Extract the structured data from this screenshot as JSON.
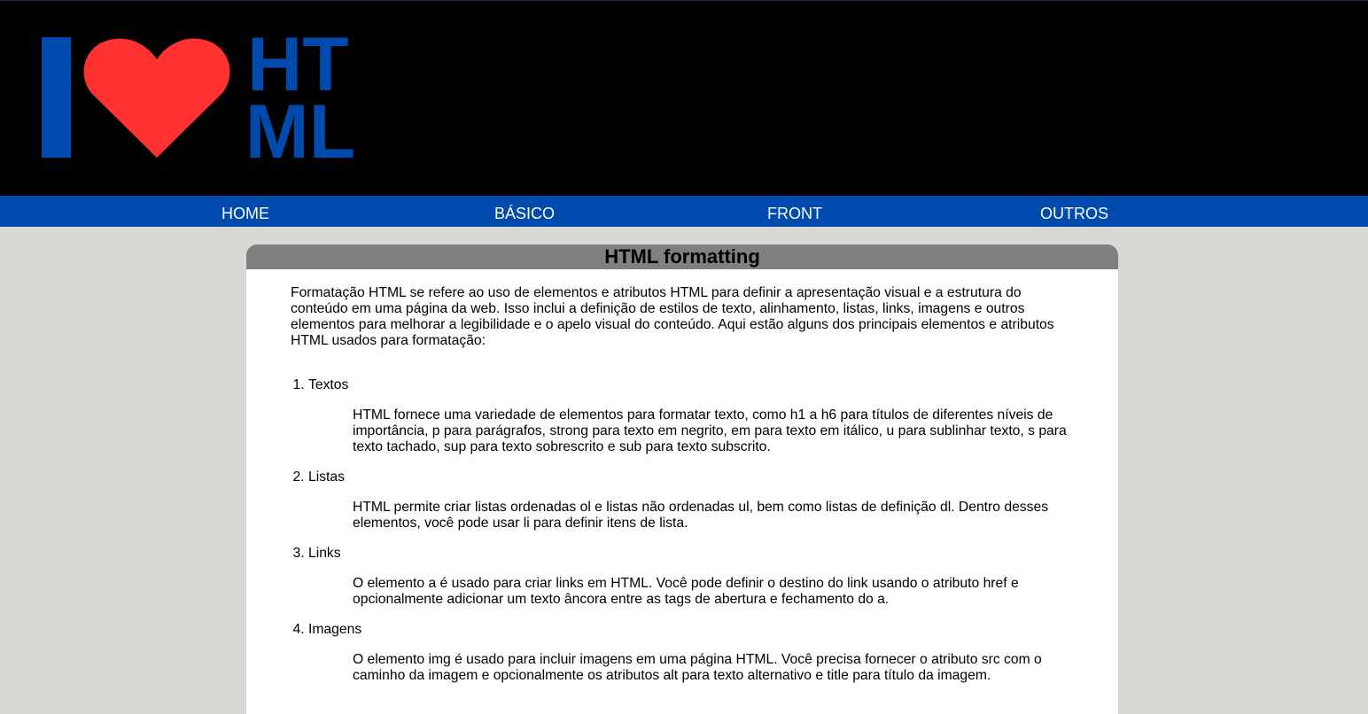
{
  "logo": {
    "icon": "heart-icon",
    "text_line1": "HT",
    "text_line2": "ML",
    "colors": {
      "blue": "#004aad",
      "heart": "#ff3131"
    }
  },
  "nav": {
    "items": [
      {
        "label": "HOME"
      },
      {
        "label": "BÁSICO"
      },
      {
        "label": "FRONT"
      },
      {
        "label": "OUTROS"
      }
    ]
  },
  "article": {
    "title": "HTML formatting",
    "intro": "Formatação HTML se refere ao uso de elementos e atributos HTML para definir a apresentação visual e a estrutura do conteúdo em uma página da web. Isso inclui a definição de estilos de texto, alinhamento, listas, links, imagens e outros elementos para melhorar a legibilidade e o apelo visual do conteúdo. Aqui estão alguns dos principais elementos e atributos HTML usados para formatação:",
    "topics": [
      {
        "name": "Textos",
        "description": "HTML fornece uma variedade de elementos para formatar texto, como h1 a h6 para títulos de diferentes níveis de importância, p para parágrafos, strong para texto em negrito, em para texto em itálico, u para sublinhar texto, s para texto tachado, sup para texto sobrescrito e sub para texto subscrito."
      },
      {
        "name": "Listas",
        "description": "HTML permite criar listas ordenadas ol e listas não ordenadas ul, bem como listas de definição dl. Dentro desses elementos, você pode usar li para definir itens de lista."
      },
      {
        "name": "Links",
        "description": "O elemento a é usado para criar links em HTML. Você pode definir o destino do link usando o atributo href e opcionalmente adicionar um texto âncora entre as tags de abertura e fechamento do a."
      },
      {
        "name": "Imagens",
        "description": "O elemento img é usado para incluir imagens em uma página HTML. Você precisa fornecer o atributo src com o caminho da imagem e opcionalmente os atributos alt para texto alternativo e title para título da imagem."
      }
    ]
  }
}
